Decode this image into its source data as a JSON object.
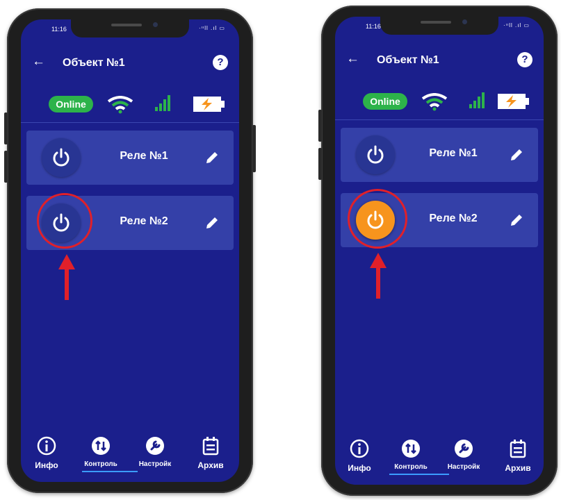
{
  "phones": [
    {
      "status_time": "11:16",
      "status_right": "·ᶦᶦll .ıl ▭",
      "title": "Объект №1",
      "online_label": "Online",
      "relays": [
        {
          "label": "Реле №1",
          "state": "off"
        },
        {
          "label": "Реле №2",
          "state": "off"
        }
      ],
      "nav": {
        "info": "Инфо",
        "control": "Контроль",
        "settings": "Настройк",
        "archive": "Архив"
      }
    },
    {
      "status_time": "11:16",
      "status_right": "·ᶦᶦll .ıl ▭",
      "title": "Объект №1",
      "online_label": "Online",
      "relays": [
        {
          "label": "Реле №1",
          "state": "off"
        },
        {
          "label": "Реле №2",
          "state": "on"
        }
      ],
      "nav": {
        "info": "Инфо",
        "control": "Контроль",
        "settings": "Настройк",
        "archive": "Архив"
      }
    }
  ],
  "colors": {
    "screen_bg": "#1b1f8c",
    "card_bg": "#3440a8",
    "online_green": "#2db34a",
    "power_on_orange": "#f7941d",
    "annotation_red": "#e0202a",
    "nav_underline": "#3b9cff"
  },
  "icons": [
    "back-arrow-icon",
    "help-icon",
    "wifi-icon",
    "signal-icon",
    "battery-charging-icon",
    "power-icon",
    "pencil-icon",
    "info-icon",
    "swap-icon",
    "wrench-icon",
    "calendar-icon"
  ]
}
